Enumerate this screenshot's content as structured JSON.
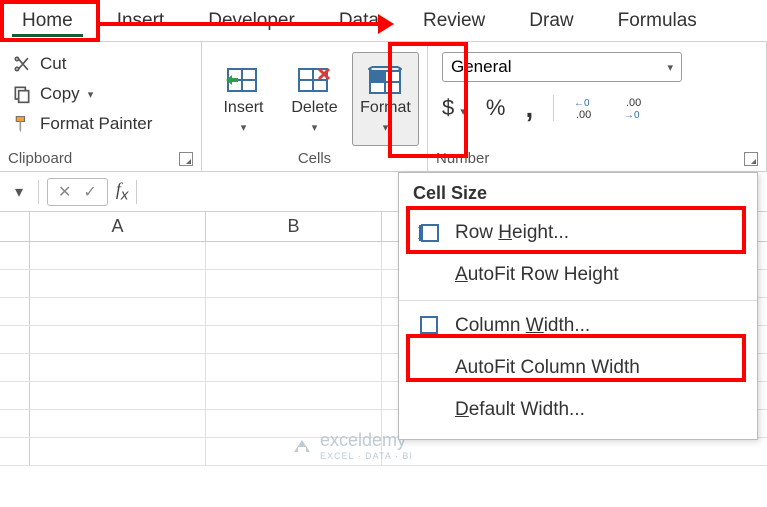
{
  "tabs": {
    "home": "Home",
    "insert": "Insert",
    "developer": "Developer",
    "data": "Data",
    "review": "Review",
    "draw": "Draw",
    "formulas": "Formulas"
  },
  "clipboard": {
    "cut": "Cut",
    "copy": "Copy",
    "format_painter": "Format Painter",
    "label": "Clipboard"
  },
  "cells": {
    "insert": "Insert",
    "delete": "Delete",
    "format": "Format",
    "label": "Cells"
  },
  "number": {
    "combo": "General",
    "label": "Number",
    "dollar": "$",
    "percent": "%",
    "comma": ",",
    "inc": "←0 .00",
    "dec": ".00 →0"
  },
  "columns": {
    "a": "A",
    "b": "B"
  },
  "menu": {
    "header": "Cell Size",
    "row_height": "Row Height...",
    "row_height_key": "H",
    "autofit_row": "AutoFit Row Height",
    "autofit_row_key": "A",
    "col_width": "Column Width...",
    "col_width_key": "W",
    "autofit_col": "AutoFit Column Width",
    "default_width": "Default Width...",
    "default_width_key": "D"
  },
  "watermark": {
    "name": "exceldemy",
    "sub": "EXCEL · DATA · BI"
  }
}
